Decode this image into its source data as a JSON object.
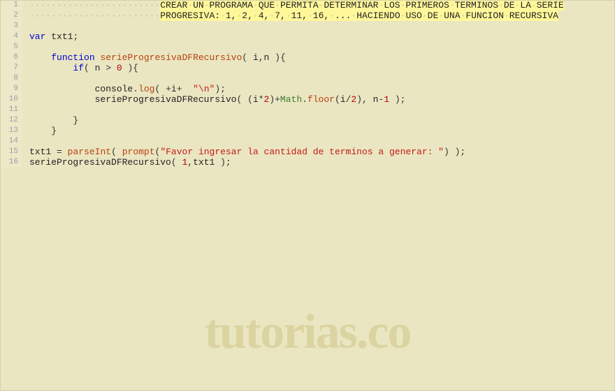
{
  "watermark": "tutorias.co",
  "code": {
    "lines": [
      {
        "n": 1,
        "type": "comment",
        "indent": 24,
        "text": "CREAR UN PROGRAMA QUE PERMITA DETERMINAR LOS PRIMEROS TERMINOS DE LA SERIE"
      },
      {
        "n": 2,
        "type": "comment",
        "indent": 24,
        "text": "PROGRESIVA: 1, 2, 4, 7, 11, 16, ... HACIENDO USO DE UNA FUNCION RECURSIVA"
      },
      {
        "n": 3,
        "type": "blank"
      },
      {
        "n": 4,
        "type": "tok",
        "tokens": [
          {
            "t": "kw",
            "v": "var"
          },
          {
            "t": "sp",
            "v": " "
          },
          {
            "t": "ident",
            "v": "txt1"
          },
          {
            "t": "punc",
            "v": ";"
          }
        ]
      },
      {
        "n": 5,
        "type": "blank"
      },
      {
        "n": 6,
        "type": "tok",
        "indent": 4,
        "tokens": [
          {
            "t": "kw",
            "v": "function"
          },
          {
            "t": "sp",
            "v": " "
          },
          {
            "t": "fn",
            "v": "serieProgresivaDFRecursivo"
          },
          {
            "t": "punc",
            "v": "( "
          },
          {
            "t": "ident",
            "v": "i"
          },
          {
            "t": "punc",
            "v": ","
          },
          {
            "t": "ident",
            "v": "n"
          },
          {
            "t": "punc",
            "v": " ){"
          }
        ]
      },
      {
        "n": 7,
        "type": "tok",
        "indent": 8,
        "tokens": [
          {
            "t": "kw",
            "v": "if"
          },
          {
            "t": "punc",
            "v": "( "
          },
          {
            "t": "ident",
            "v": "n"
          },
          {
            "t": "sp",
            "v": " "
          },
          {
            "t": "punc",
            "v": ">"
          },
          {
            "t": "sp",
            "v": " "
          },
          {
            "t": "num",
            "v": "0"
          },
          {
            "t": "punc",
            "v": " ){"
          }
        ]
      },
      {
        "n": 8,
        "type": "blank",
        "indent": 8
      },
      {
        "n": 9,
        "type": "tok",
        "indent": 12,
        "tokens": [
          {
            "t": "ident",
            "v": "console"
          },
          {
            "t": "punc",
            "v": "."
          },
          {
            "t": "fn",
            "v": "log"
          },
          {
            "t": "punc",
            "v": "( "
          },
          {
            "t": "punc",
            "v": "+"
          },
          {
            "t": "ident",
            "v": "i"
          },
          {
            "t": "punc",
            "v": "+"
          },
          {
            "t": "sp",
            "v": "  "
          },
          {
            "t": "str",
            "v": "\"\\n\""
          },
          {
            "t": "punc",
            "v": ");"
          }
        ]
      },
      {
        "n": 10,
        "type": "tok",
        "indent": 12,
        "tokens": [
          {
            "t": "ident",
            "v": "serieProgresivaDFRecursivo"
          },
          {
            "t": "punc",
            "v": "( ("
          },
          {
            "t": "ident",
            "v": "i"
          },
          {
            "t": "punc",
            "v": "*"
          },
          {
            "t": "num",
            "v": "2"
          },
          {
            "t": "punc",
            "v": ")+"
          },
          {
            "t": "obj",
            "v": "Math"
          },
          {
            "t": "punc",
            "v": "."
          },
          {
            "t": "fn",
            "v": "floor"
          },
          {
            "t": "punc",
            "v": "("
          },
          {
            "t": "ident",
            "v": "i"
          },
          {
            "t": "punc",
            "v": "/"
          },
          {
            "t": "num",
            "v": "2"
          },
          {
            "t": "punc",
            "v": "), "
          },
          {
            "t": "ident",
            "v": "n"
          },
          {
            "t": "punc",
            "v": "-"
          },
          {
            "t": "num",
            "v": "1"
          },
          {
            "t": "punc",
            "v": " );"
          }
        ]
      },
      {
        "n": 11,
        "type": "blank",
        "indent": 12
      },
      {
        "n": 12,
        "type": "tok",
        "indent": 8,
        "tokens": [
          {
            "t": "punc",
            "v": "}"
          }
        ]
      },
      {
        "n": 13,
        "type": "tok",
        "indent": 4,
        "tokens": [
          {
            "t": "punc",
            "v": "}"
          }
        ]
      },
      {
        "n": 14,
        "type": "blank"
      },
      {
        "n": 15,
        "type": "tok",
        "tokens": [
          {
            "t": "ident",
            "v": "txt1"
          },
          {
            "t": "sp",
            "v": " "
          },
          {
            "t": "punc",
            "v": "="
          },
          {
            "t": "sp",
            "v": " "
          },
          {
            "t": "fn",
            "v": "parseInt"
          },
          {
            "t": "punc",
            "v": "( "
          },
          {
            "t": "fn",
            "v": "prompt"
          },
          {
            "t": "punc",
            "v": "("
          },
          {
            "t": "str",
            "v": "\"Favor ingresar la cantidad de terminos a generar: \""
          },
          {
            "t": "punc",
            "v": ") );"
          }
        ]
      },
      {
        "n": 16,
        "type": "tok",
        "tokens": [
          {
            "t": "ident",
            "v": "serieProgresivaDFRecursivo"
          },
          {
            "t": "punc",
            "v": "( "
          },
          {
            "t": "num",
            "v": "1"
          },
          {
            "t": "punc",
            "v": ","
          },
          {
            "t": "ident",
            "v": "txt1"
          },
          {
            "t": "punc",
            "v": " );"
          }
        ]
      }
    ]
  }
}
